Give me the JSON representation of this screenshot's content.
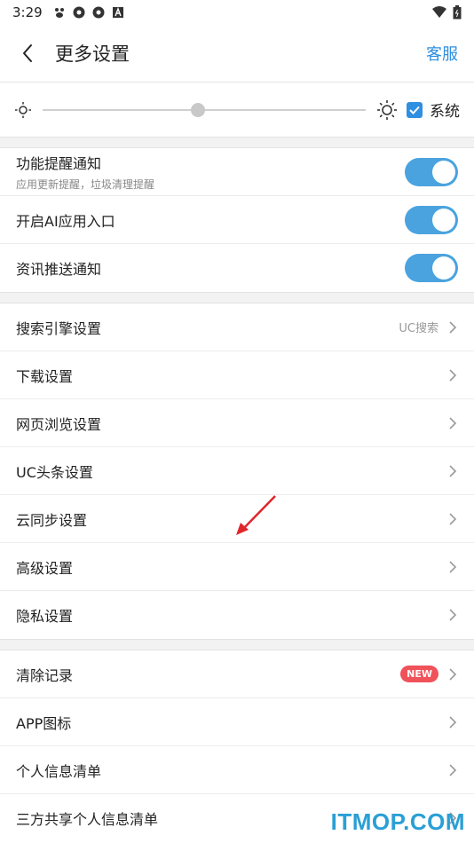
{
  "status_bar": {
    "time": "3:29",
    "icons": [
      "baidu-icon",
      "shutter-icon",
      "shutter-icon",
      "a-box-icon"
    ],
    "right_icons": [
      "wifi-icon",
      "battery-icon"
    ]
  },
  "header": {
    "title": "更多设置",
    "service_label": "客服"
  },
  "brightness": {
    "level": 0.48,
    "system_checked": true,
    "system_label": "系统"
  },
  "toggles": [
    {
      "label": "功能提醒通知",
      "sub": "应用更新提醒，垃圾清理提醒",
      "on": true
    },
    {
      "label": "开启AI应用入口",
      "on": true
    },
    {
      "label": "资讯推送通知",
      "on": true
    }
  ],
  "settings": [
    {
      "label": "搜索引擎设置",
      "value": "UC搜索"
    },
    {
      "label": "下载设置"
    },
    {
      "label": "网页浏览设置"
    },
    {
      "label": "UC头条设置"
    },
    {
      "label": "云同步设置"
    },
    {
      "label": "高级设置"
    },
    {
      "label": "隐私设置"
    }
  ],
  "more": [
    {
      "label": "清除记录",
      "badge": "NEW"
    },
    {
      "label": "APP图标"
    },
    {
      "label": "个人信息清单"
    },
    {
      "label": "三方共享个人信息清单"
    }
  ],
  "watermark": "ITMOP.COM",
  "colors": {
    "accent": "#2f8fe0",
    "toggle_on": "#4aa3df",
    "badge": "#f0525a",
    "annotation_arrow": "#e0262a"
  }
}
